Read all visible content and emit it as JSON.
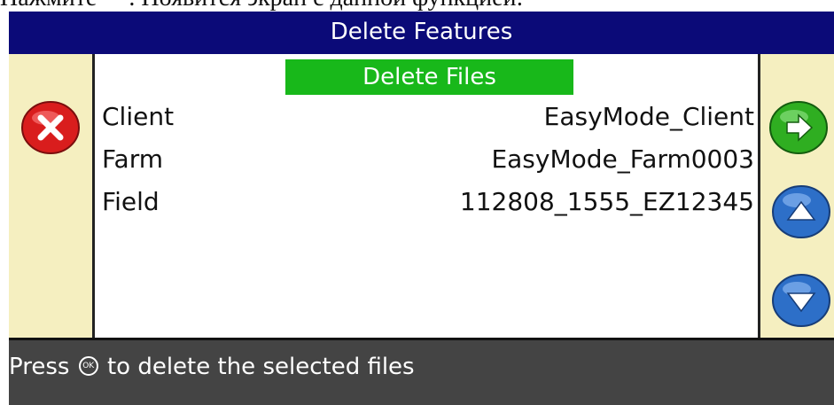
{
  "doc_caption": {
    "prefix": "Нажмите",
    "suffix": ". Появится экран с данной функцией:"
  },
  "window": {
    "title": "Delete Features"
  },
  "main": {
    "header": "Delete Files",
    "rows": [
      {
        "label": "Client",
        "value": "EasyMode_Client"
      },
      {
        "label": "Farm",
        "value": "EasyMode_Farm0003"
      },
      {
        "label": "Field",
        "value": "112808_1555_EZ12345"
      }
    ]
  },
  "footer": {
    "press": "Press",
    "ok_icon": "OK",
    "message": "to delete the selected files"
  },
  "buttons": {
    "cancel_icon": "close-x-icon",
    "next_icon": "arrow-right-icon",
    "up_icon": "arrow-up-icon",
    "down_icon": "arrow-down-icon"
  },
  "colors": {
    "titlebar": "#0b0a78",
    "header_bar": "#18b81a",
    "side_panels": "#f5efc0",
    "footer": "#444444",
    "cancel": "#d91d1d",
    "next": "#2fae21",
    "nav": "#2d6fc8"
  }
}
